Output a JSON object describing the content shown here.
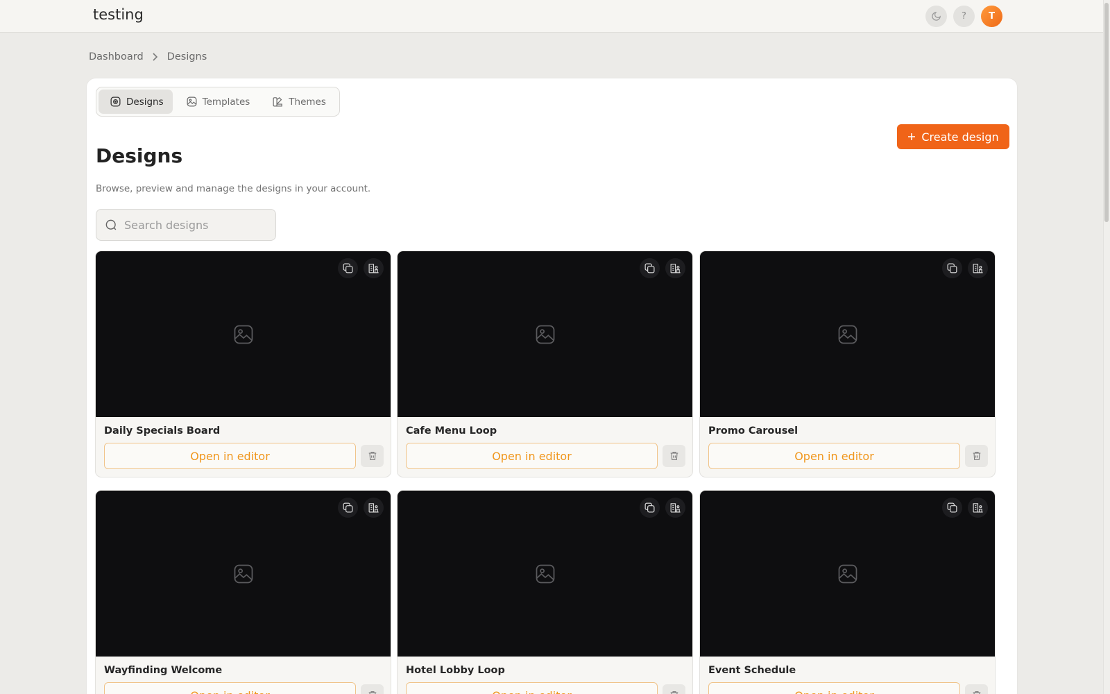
{
  "app": {
    "title": "testing",
    "avatar_initial": "T",
    "help_glyph": "?"
  },
  "breadcrumb": [
    "Dashboard",
    "Designs"
  ],
  "tabs": [
    {
      "label": "Designs",
      "icon": "designs-icon",
      "active": true
    },
    {
      "label": "Templates",
      "icon": "image-icon",
      "active": false
    },
    {
      "label": "Themes",
      "icon": "themes-icon",
      "active": false
    }
  ],
  "page": {
    "create_label": "Create design",
    "title": "Designs",
    "description": "Browse, preview and manage the designs in your account."
  },
  "search": {
    "placeholder": "Search designs",
    "value": ""
  },
  "cards": [
    {
      "name": "Daily Specials Board",
      "action": "Open in editor"
    },
    {
      "name": "Cafe Menu Loop",
      "action": "Open in editor"
    },
    {
      "name": "Promo Carousel",
      "action": "Open in editor"
    },
    {
      "name": "Wayfinding Welcome",
      "action": "Open in editor"
    },
    {
      "name": "Hotel Lobby Loop",
      "action": "Open in editor"
    },
    {
      "name": "Event Schedule",
      "action": "Open in editor"
    }
  ],
  "colors": {
    "accent": "#f06418",
    "accent_text": "#f0961c",
    "background": "#ecebe8",
    "preview": "#0e0e10"
  }
}
